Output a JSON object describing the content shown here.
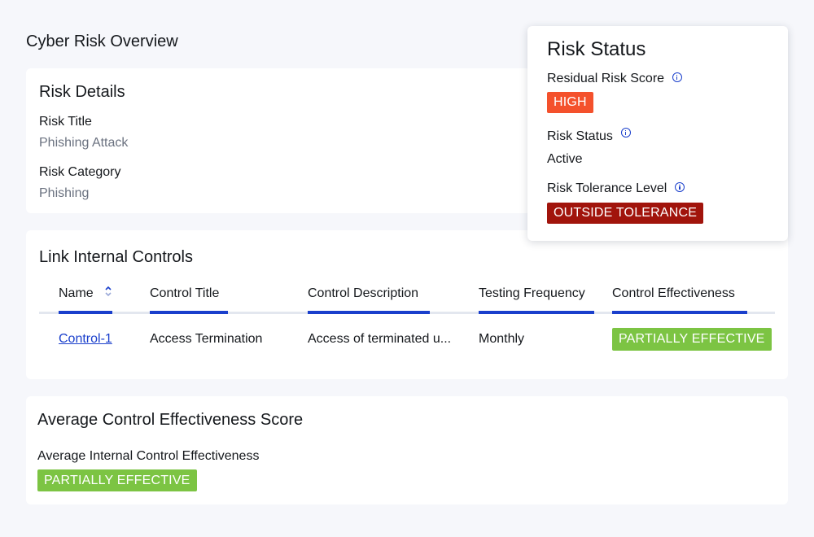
{
  "page": {
    "title": "Cyber Risk Overview"
  },
  "risk_details": {
    "title": "Risk Details",
    "risk_title_label": "Risk Title",
    "risk_title_value": "Phishing Attack",
    "risk_category_label": "Risk Category",
    "risk_category_value": "Phishing"
  },
  "risk_status": {
    "title": "Risk Status",
    "residual_label": "Residual Risk Score",
    "residual_value": "HIGH",
    "status_label": "Risk Status",
    "status_value": "Active",
    "tolerance_label": "Risk Tolerance Level",
    "tolerance_value": "OUTSIDE TOLERANCE",
    "colors": {
      "high": "#f4512c",
      "outside": "#a1140c",
      "info_icon": "#1a3fcc"
    }
  },
  "link_controls": {
    "title": "Link Internal Controls",
    "columns": [
      "Name",
      "Control Title",
      "Control Description",
      "Testing Frequency",
      "Control Effectiveness"
    ],
    "rows": [
      {
        "name": "Control-1",
        "control_title": "Access Termination",
        "control_description": "Access of terminated u...",
        "testing_frequency": "Monthly",
        "control_effectiveness": "PARTIALLY EFFECTIVE"
      }
    ],
    "sort_icon": "sort-chevrons-icon",
    "colors": {
      "accent": "#1a3fcc",
      "partial": "#7cc443"
    }
  },
  "avg_score": {
    "title": "Average Control Effectiveness Score",
    "label": "Average Internal Control Effectiveness",
    "value": "PARTIALLY EFFECTIVE"
  }
}
